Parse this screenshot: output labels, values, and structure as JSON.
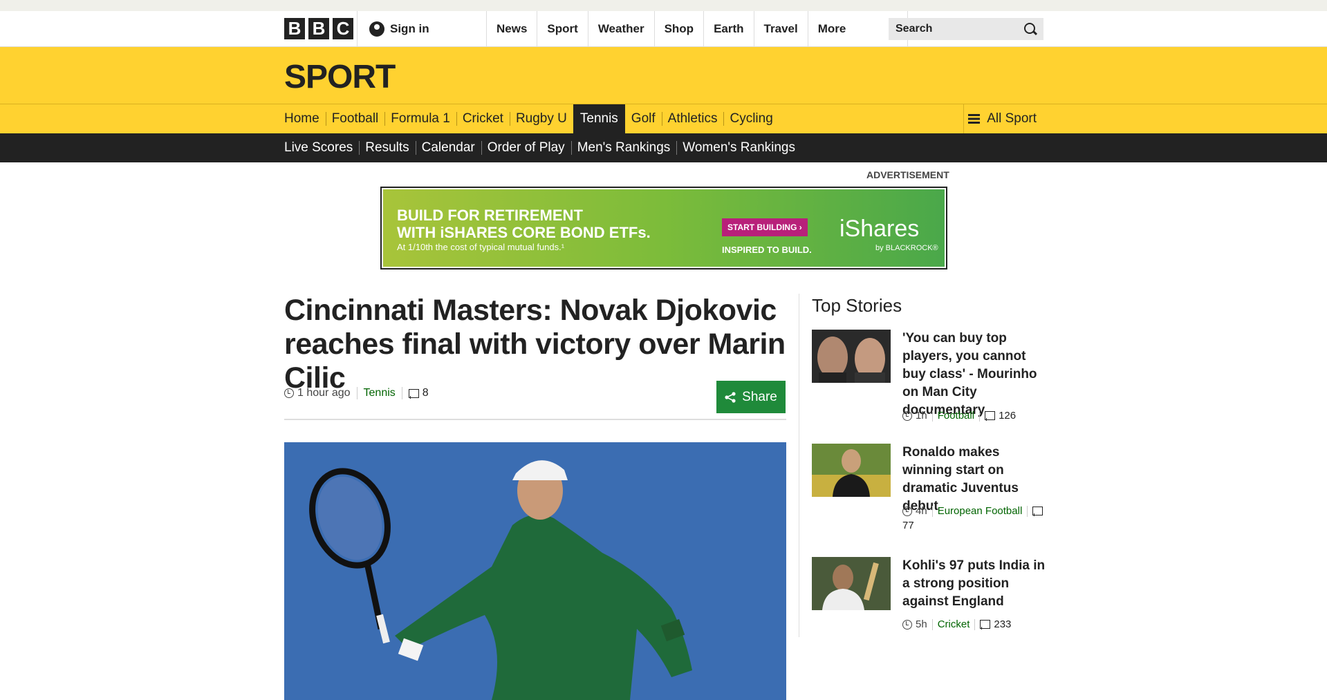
{
  "global_nav": {
    "logo_letters": [
      "B",
      "B",
      "C"
    ],
    "signin_label": "Sign in",
    "links": [
      "News",
      "Sport",
      "Weather",
      "Shop",
      "Earth",
      "Travel"
    ],
    "more_label": "More",
    "search_placeholder": "Search"
  },
  "sport_header": {
    "title": "SPORT"
  },
  "sport_nav": {
    "items": [
      "Home",
      "Football",
      "Formula 1",
      "Cricket",
      "Rugby U",
      "Tennis",
      "Golf",
      "Athletics",
      "Cycling"
    ],
    "active": "Tennis",
    "all_sport_label": "All Sport"
  },
  "tennis_nav": {
    "items": [
      "Live Scores",
      "Results",
      "Calendar",
      "Order of Play",
      "Men's Rankings",
      "Women's Rankings"
    ]
  },
  "advert": {
    "label": "ADVERTISEMENT",
    "headline_line1": "BUILD FOR RETIREMENT",
    "headline_line2": "WITH iSHARES CORE BOND ETFs.",
    "small_text": "At 1/10th the cost of typical mutual funds.¹",
    "button_label": "START BUILDING ›",
    "inspired": "INSPIRED TO BUILD.",
    "brand": "iShares",
    "brand_by": "by BLACKROCK®"
  },
  "article": {
    "headline": "Cincinnati Masters: Novak Djokovic reaches final with victory over Marin Cilic",
    "time": "1 hour ago",
    "section": "Tennis",
    "comments": "8",
    "share_label": "Share"
  },
  "top_stories": {
    "heading": "Top Stories",
    "items": [
      {
        "title": "'You can buy top players, you cannot buy class' - Mourinho on Man City documentary",
        "time": "1h",
        "section": "Football",
        "comments": "126"
      },
      {
        "title": "Ronaldo makes winning start on dramatic Juventus debut",
        "time": "4h",
        "section": "European Football",
        "comments": "77"
      },
      {
        "title": "Kohli's 97 puts India in a strong position against England",
        "time": "5h",
        "section": "Cricket",
        "comments": "233"
      }
    ]
  },
  "colors": {
    "sport_yellow": "#ffd230",
    "nav_dark": "#222222",
    "share_green": "#1f8a3a",
    "link_green": "#006400"
  }
}
